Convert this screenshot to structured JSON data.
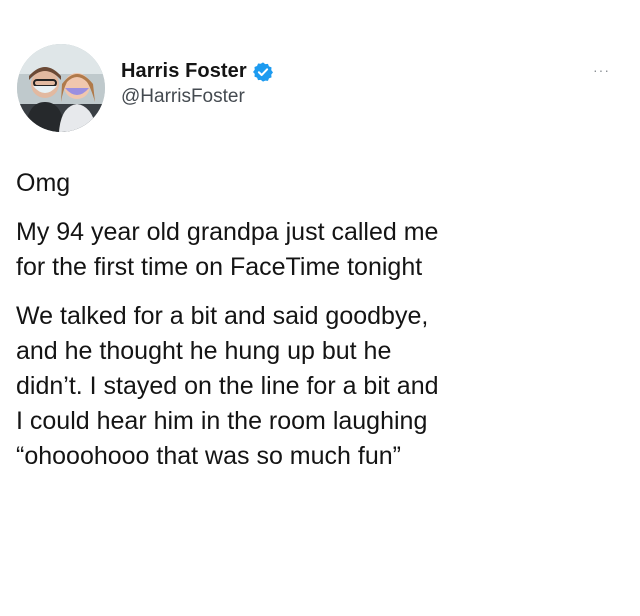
{
  "tweet": {
    "author": {
      "name": "Harris Foster",
      "handle": "@HarrisFoster",
      "verified": true,
      "avatar_icon": "avatar-photo"
    },
    "more_label": "···",
    "paragraphs": [
      [
        "Omg"
      ],
      [
        "My 94 year old grandpa just called me",
        "for the first time on FaceTime tonight"
      ],
      [
        "We talked for a bit and said goodbye,",
        "and he thought he hung up but he",
        "didn’t. I stayed on the line for a bit and",
        "I could hear him in the room laughing",
        "“ohooohooo that was so much fun”"
      ]
    ]
  },
  "colors": {
    "verified_badge": "#1d9bf0",
    "text": "#141414",
    "handle": "#444a50"
  }
}
